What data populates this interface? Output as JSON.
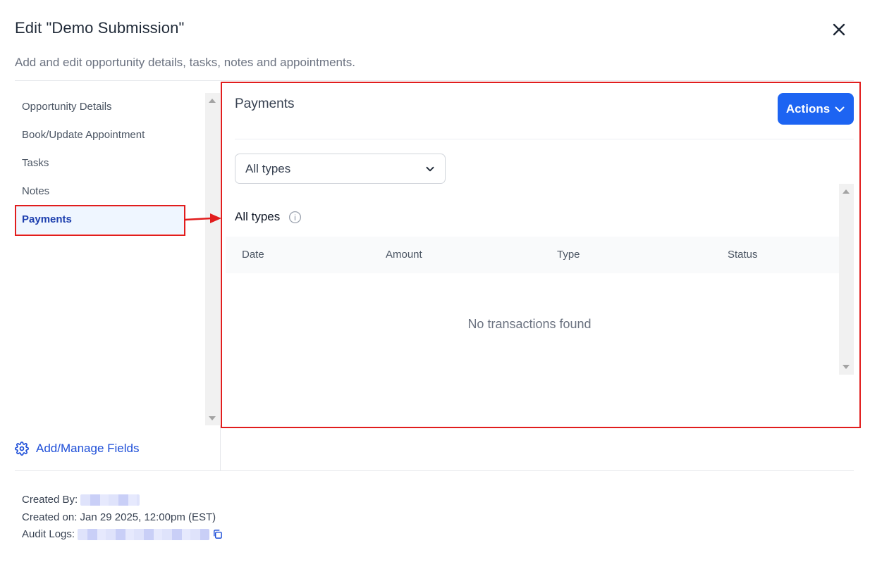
{
  "header": {
    "title": "Edit \"Demo Submission\"",
    "subtitle": "Add and edit opportunity details, tasks, notes and appointments."
  },
  "sidebar": {
    "items": [
      {
        "label": "Opportunity Details"
      },
      {
        "label": "Book/Update Appointment"
      },
      {
        "label": "Tasks"
      },
      {
        "label": "Notes"
      },
      {
        "label": "Payments"
      }
    ],
    "active_index": 4
  },
  "add_fields": {
    "label": "Add/Manage Fields"
  },
  "meta": {
    "created_by_label": "Created By:",
    "created_on": "Created on: Jan 29 2025, 12:00pm (EST)",
    "audit_logs_label": "Audit Logs:"
  },
  "panel": {
    "title": "Payments",
    "actions_label": "Actions",
    "filter": {
      "selected": "All types"
    },
    "section_title": "All types",
    "columns": [
      "Date",
      "Amount",
      "Type",
      "Status"
    ],
    "empty_message": "No transactions found"
  },
  "colors": {
    "accent": "#1d64f2",
    "link": "#1d4ed8",
    "annotation": "#e11d1d",
    "active_bg": "#eff6ff"
  }
}
